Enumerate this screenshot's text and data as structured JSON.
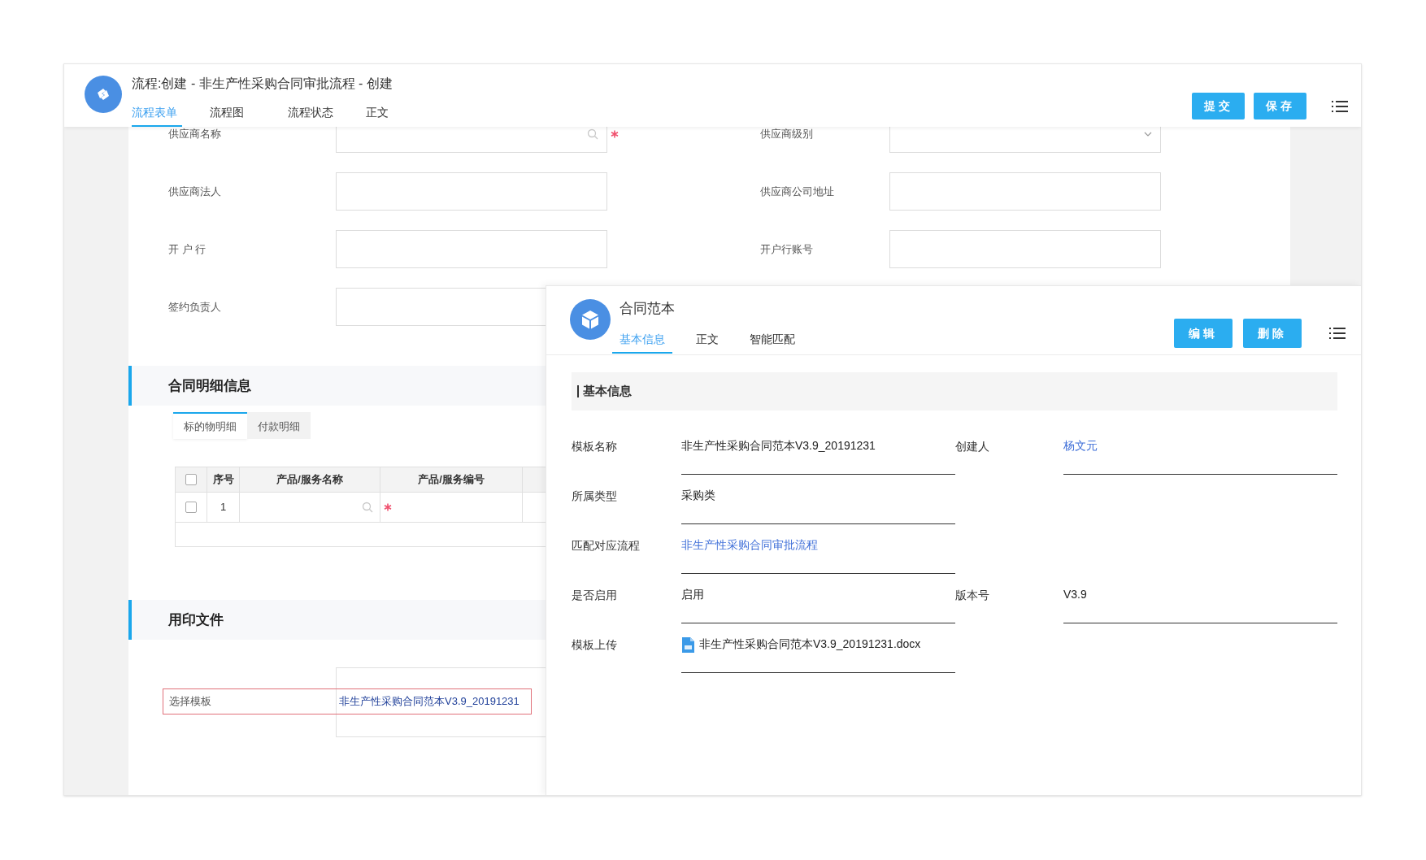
{
  "window": {
    "title": "流程:创建 - 非生产性采购合同审批流程 - 创建"
  },
  "tabs": [
    {
      "label": "流程表单",
      "selected": true
    },
    {
      "label": "流程图",
      "selected": false
    },
    {
      "label": "流程状态",
      "selected": false
    },
    {
      "label": "正文",
      "selected": false
    }
  ],
  "actions": [
    "提交",
    "保存"
  ],
  "form_rows": [
    {
      "fields": [
        {
          "label": "供应商名称",
          "kind": "search",
          "required": true
        },
        {
          "label": "供应商级别",
          "kind": "select",
          "required": false
        }
      ]
    },
    {
      "fields": [
        {
          "label": "供应商法人",
          "kind": "text",
          "required": false
        },
        {
          "label": "供应商公司地址",
          "kind": "text",
          "required": false
        }
      ]
    },
    {
      "fields": [
        {
          "label": "开 户 行",
          "kind": "text",
          "required": false
        },
        {
          "label": "开户行账号",
          "kind": "text",
          "required": false
        }
      ]
    },
    {
      "fields": [
        {
          "label": "签约负责人",
          "kind": "text",
          "required": false
        }
      ]
    }
  ],
  "contract_details": {
    "title": "合同明细信息",
    "tabs": [
      {
        "label": "标的物明细",
        "selected": true
      },
      {
        "label": "付款明细",
        "selected": false
      }
    ],
    "table": {
      "header_checked": false,
      "columns": [
        "序号",
        "产品/服务名称",
        "产品/服务编号"
      ],
      "rows": [
        {
          "checked": false,
          "number": "1",
          "required": true
        }
      ]
    }
  },
  "stamp_files": {
    "title": "用印文件",
    "field": {
      "label": "选择模板",
      "value": "非生产性采购合同范本V3.9_20191231",
      "highlighted": true
    }
  },
  "template_panel": {
    "title": "合同范本",
    "tabs": [
      {
        "label": "基本信息",
        "selected": true
      },
      {
        "label": "正文",
        "selected": false
      },
      {
        "label": "智能匹配",
        "selected": false
      }
    ],
    "actions": [
      "编辑",
      "删除"
    ],
    "section_title": "基本信息",
    "rows": [
      {
        "fields": [
          {
            "label": "模板名称",
            "value": "非生产性采购合同范本V3.9_20191231",
            "kind": "text"
          },
          {
            "label": "创建人",
            "value": "杨文元",
            "kind": "link"
          }
        ]
      },
      {
        "fields": [
          {
            "label": "所属类型",
            "value": "采购类",
            "kind": "text"
          }
        ]
      },
      {
        "fields": [
          {
            "label": "匹配对应流程",
            "value": "非生产性采购合同审批流程",
            "kind": "link"
          }
        ]
      },
      {
        "fields": [
          {
            "label": "是否启用",
            "value": "启用",
            "kind": "text"
          },
          {
            "label": "版本号",
            "value": "V3.9",
            "kind": "text"
          }
        ]
      },
      {
        "fields": [
          {
            "label": "模板上传",
            "value": "非生产性采购合同范本V3.9_20191231.docx",
            "kind": "file"
          }
        ]
      }
    ]
  }
}
